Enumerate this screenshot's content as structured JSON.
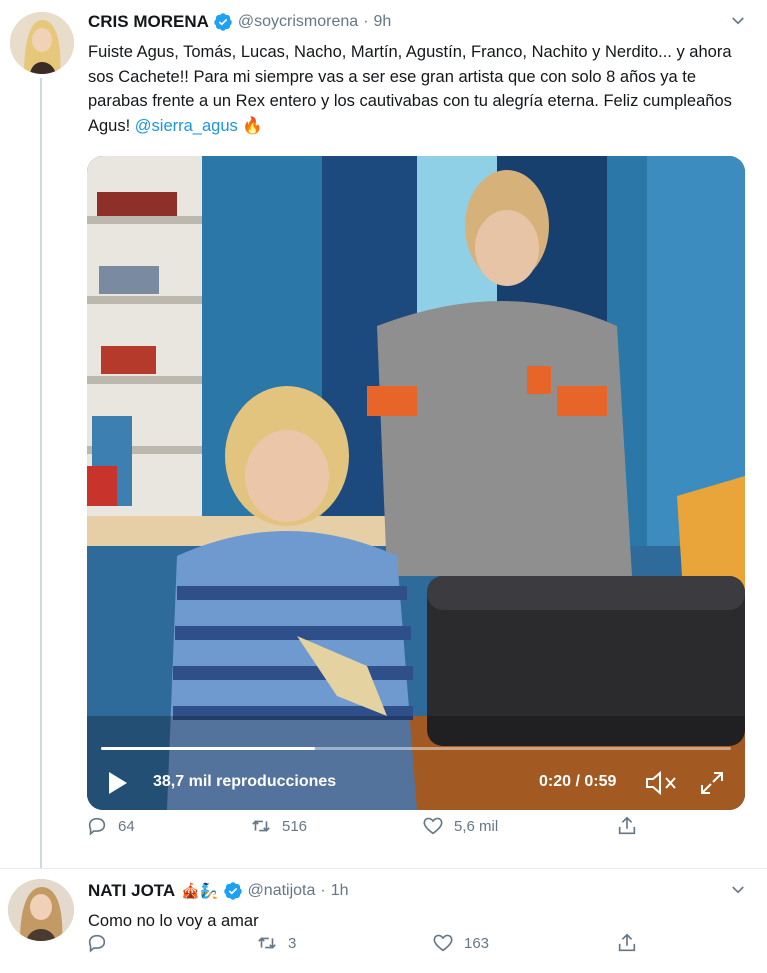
{
  "tweets": [
    {
      "name": "CRIS MORENA",
      "handle": "@soycrismorena",
      "time": "9h",
      "text_main": "Fuiste Agus, Tomás, Lucas, Nacho, Martín, Agustín, Franco, Nachito y Nerdito... y ahora sos Cachete!! Para mi siempre vas a ser ese gran artista que con solo 8 años ya te parabas frente a un Rex entero y los cautivabas con tu alegría eterna. Feliz cumpleaños Agus!",
      "mention": "@sierra_agus",
      "trailing_emoji": "🔥",
      "video": {
        "views": "38,7 mil reproducciones",
        "time": "0:20 / 0:59",
        "progress": 0.339
      },
      "replies": "64",
      "retweets": "516",
      "likes": "5,6 mil"
    },
    {
      "name": "NATI JOTA",
      "badges": "🎪🧞",
      "handle": "@natijota",
      "time": "1h",
      "text": "Como no lo voy a amar",
      "replies": "",
      "retweets": "3",
      "likes": "163"
    }
  ],
  "colors": {
    "accent": "#1b95e0",
    "muted": "#657786",
    "verified": "#1da1f2"
  },
  "icons": [
    "verified-badge-icon",
    "chevron-down-icon",
    "play-icon",
    "mute-icon",
    "expand-icon",
    "reply-icon",
    "retweet-icon",
    "like-icon",
    "share-icon"
  ]
}
